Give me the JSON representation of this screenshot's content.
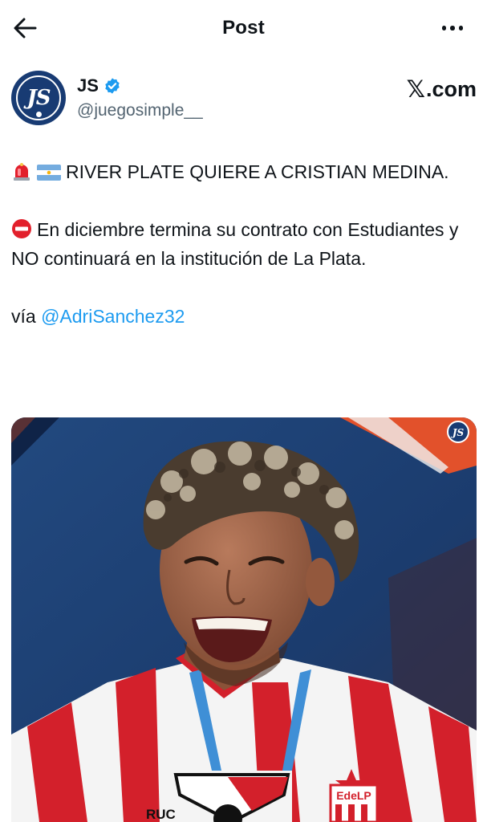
{
  "header": {
    "title": "Post",
    "back_icon": "arrow-left-icon",
    "more_icon": "more-horizontal-icon"
  },
  "author": {
    "name": "JS",
    "handle": "@juegosimple__",
    "avatar_text": "JS",
    "verified": true,
    "verified_color": "#1d9bf0"
  },
  "source": {
    "x_glyph": "𝕏",
    "label": ".com"
  },
  "post": {
    "line1": "RIVER PLATE QUIERE A CRISTIAN MEDINA.",
    "line1_icons": [
      "rotating-light-icon",
      "argentina-flag-icon"
    ],
    "line2": "En diciembre termina su contrato con Estudiantes y NO continuará en la institución de La Plata.",
    "line2_icon": "no-entry-icon",
    "via_label": "vía ",
    "via_mention": "@AdriSanchez32"
  },
  "media": {
    "watermark": "JS",
    "jersey_text": "RUC",
    "crest_text": "EdeLP"
  },
  "colors": {
    "link": "#1d9bf0",
    "secondary_text": "#536471",
    "brand_navy": "#183b73"
  }
}
